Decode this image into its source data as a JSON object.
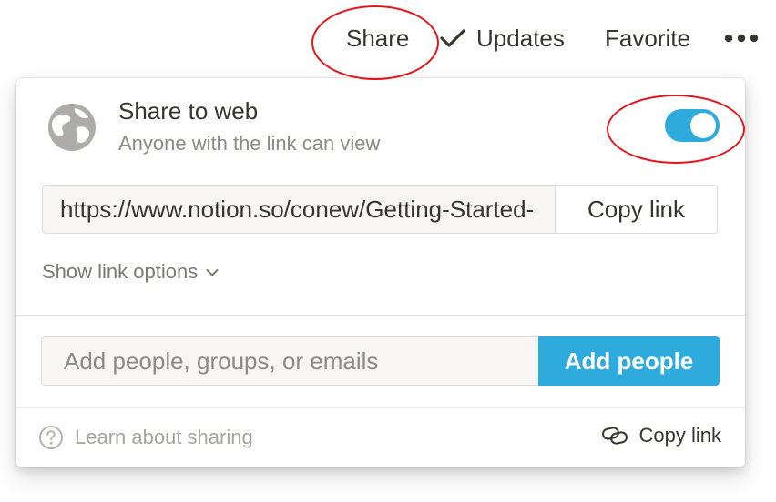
{
  "topbar": {
    "share_label": "Share",
    "updates_label": "Updates",
    "favorite_label": "Favorite",
    "more_icon": "more-horizontal-icon"
  },
  "share_popup": {
    "web_title": "Share to web",
    "web_subtitle": "Anyone with the link can view",
    "share_to_web_enabled": true,
    "url": "https://www.notion.so/conew/Getting-Started-",
    "copy_link_label": "Copy link",
    "link_options_label": "Show link options",
    "invite_placeholder": "Add people, groups, or emails",
    "add_people_label": "Add people",
    "learn_label": "Learn about sharing",
    "footer_copy_label": "Copy link"
  },
  "colors": {
    "accent": "#2eaadc",
    "annotation": "#e5141b",
    "text_primary": "#37352f",
    "text_secondary": "#8b8a86"
  }
}
